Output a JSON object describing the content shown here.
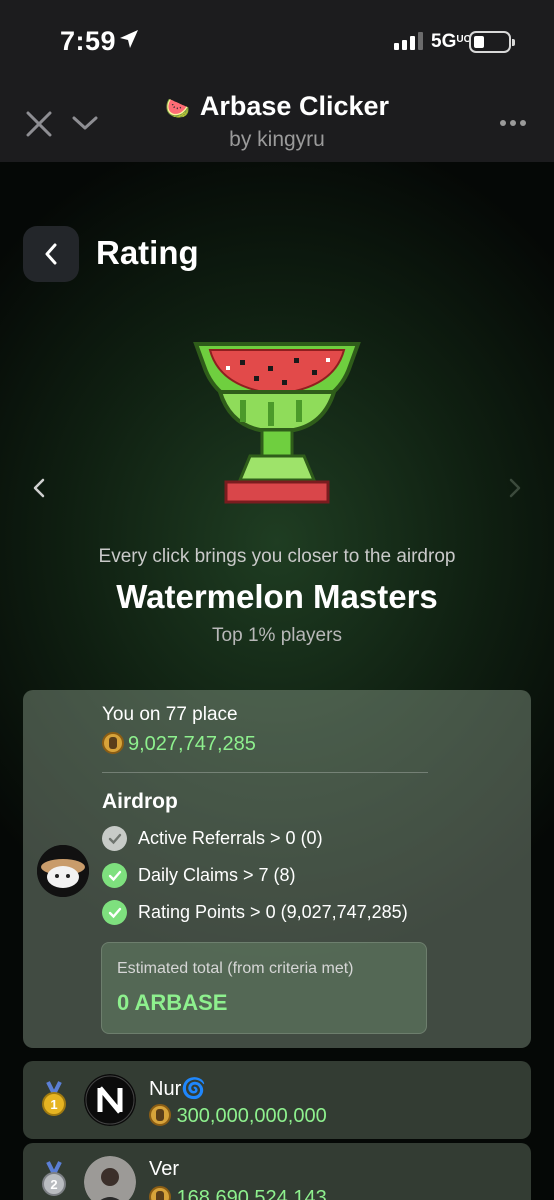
{
  "status_bar": {
    "time": "7:59",
    "network": "5G",
    "network_suffix": "UC"
  },
  "header": {
    "title": "Arbase Clicker",
    "subtitle": "by kingyru",
    "icon": "watermelon-emoji"
  },
  "page": {
    "title": "Rating",
    "tagline": "Every click brings you closer to the airdrop",
    "league_name": "Watermelon Masters",
    "league_sub": "Top 1% players"
  },
  "me": {
    "place_text": "You on 77 place",
    "score": "9,027,747,285",
    "airdrop_title": "Airdrop",
    "criteria": [
      {
        "label": "Active Referrals > 0 (0)",
        "met": false
      },
      {
        "label": "Daily Claims > 7 (8)",
        "met": true
      },
      {
        "label": "Rating Points > 0 (9,027,747,285)",
        "met": true
      }
    ],
    "estimate_label": "Estimated total (from criteria met)",
    "estimate_value": "0 ARBASE"
  },
  "leaderboard": [
    {
      "rank": "1",
      "name": "Nur",
      "name_emoji": "🌀",
      "score": "300,000,000,000"
    },
    {
      "rank": "2",
      "name": "Ver",
      "name_emoji": "",
      "score": "168,690,524,143"
    }
  ],
  "colors": {
    "accent_green": "#8ef08e",
    "background": "#0f1f11",
    "header": "#1c1c1e"
  }
}
